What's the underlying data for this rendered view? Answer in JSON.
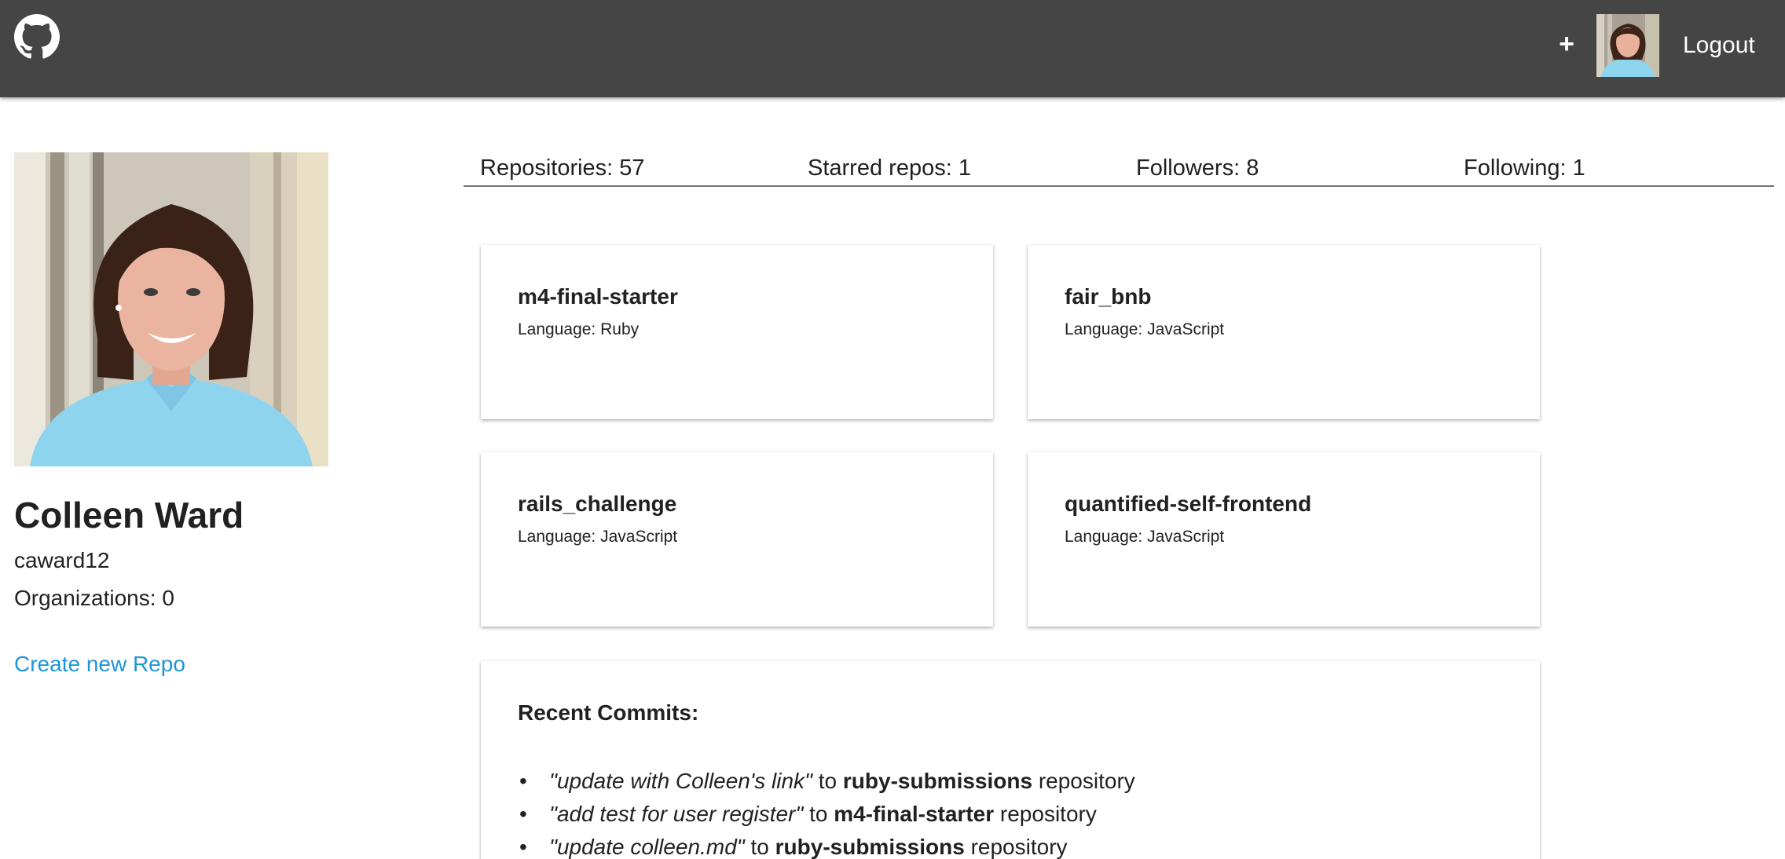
{
  "header": {
    "logo_icon": "github-octocat-icon",
    "add_label": "+",
    "avatar_icon": "user-avatar-icon",
    "logout_label": "Logout",
    "background": "#454545"
  },
  "profile": {
    "name": "Colleen Ward",
    "login": "caward12",
    "organizations": "Organizations: 0",
    "create_repo_label": "Create new Repo",
    "link_color": "#1e96d6"
  },
  "stats": {
    "repositories": "Repositories: 57",
    "starred": "Starred repos: 1",
    "followers": "Followers: 8",
    "following": "Following: 1"
  },
  "repos": [
    {
      "name": "m4-final-starter",
      "language": "Language: Ruby"
    },
    {
      "name": "fair_bnb",
      "language": "Language: JavaScript"
    },
    {
      "name": "rails_challenge",
      "language": "Language: JavaScript"
    },
    {
      "name": "quantified-self-frontend",
      "language": "Language: JavaScript"
    }
  ],
  "commits": {
    "title": "Recent Commits:",
    "items": [
      {
        "message": "\"update with Colleen's link\"",
        "to": " to ",
        "repo": "ruby-submissions",
        "suffix": " repository"
      },
      {
        "message": "\"add test for user register\"",
        "to": " to ",
        "repo": "m4-final-starter",
        "suffix": " repository"
      },
      {
        "message": "\"update colleen.md\"",
        "to": " to ",
        "repo": "ruby-submissions",
        "suffix": " repository"
      }
    ]
  }
}
